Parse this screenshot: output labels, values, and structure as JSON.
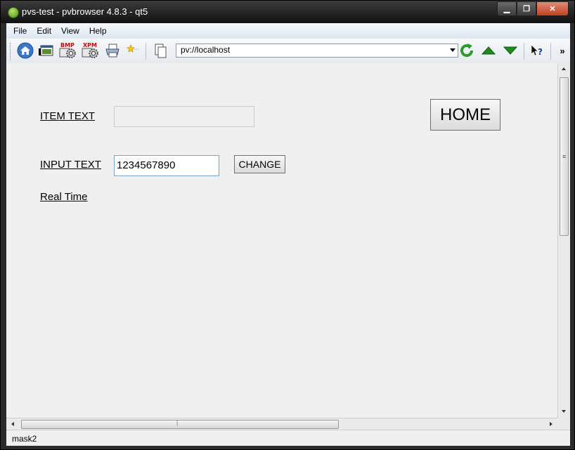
{
  "window": {
    "title": "pvs-test - pvbrowser 4.8.3 - qt5",
    "minimize_glyph": "▁",
    "maximize_glyph": "❐",
    "close_glyph": "✕"
  },
  "menu": {
    "items": [
      "File",
      "Edit",
      "View",
      "Help"
    ]
  },
  "toolbar": {
    "icons": [
      "home-icon",
      "window-icon",
      "bmp-gear-icon",
      "xpm-gear-icon",
      "printer-icon",
      "star-icon",
      "copy-icon",
      "reload-icon",
      "arrow-up-icon",
      "arrow-down-icon",
      "whats-this-icon"
    ],
    "bmp_label": "BMP",
    "xpm_label": "XPM",
    "url": "pv://localhost",
    "help_label": "?",
    "overflow_label": "»"
  },
  "mask": {
    "item_text_label": "ITEM TEXT",
    "item_text_value": "",
    "input_text_label": "INPUT TEXT",
    "input_text_value": "1234567890",
    "change_button": "CHANGE",
    "home_button": "HOME",
    "realtime_link": "Real Time"
  },
  "status": {
    "text": "mask2"
  },
  "colors": {
    "reload": "#2e9a2e",
    "arrows": "#1f8a1f",
    "home": "#3a78c9"
  }
}
